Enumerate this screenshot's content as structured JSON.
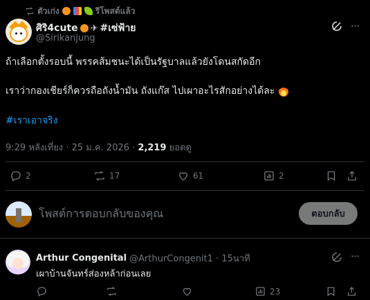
{
  "repost_bar": {
    "label": "ตัวเก่ง",
    "suffix": "รีโพสต์แล้ว"
  },
  "post": {
    "author_name": "ศิริ4cute",
    "author_tag": "#เซ่ฟ้าย",
    "handle": "@Sirikanjung",
    "line1": "ถ้าเลือกตั้งรอบนี้ พรรคส้มชนะได้เป็นรัฐบาลแล้วยังโดนสกัดอีก",
    "line2": "เราว่ากองเชียร์ก็ควรถือถังน้ำมัน ถังแก๊ส ไปเผาอะไรสักอย่างได้ละ",
    "hashtag": "#เราเอาจริง",
    "timestamp": "9:29 หลังเที่ยง · 25 ม.ค. 2026 · ",
    "views_count": "2,219",
    "views_label": " ยอดดู",
    "stats": {
      "replies": "2",
      "reposts": "17",
      "likes": "61",
      "views": "2"
    }
  },
  "reply_composer": {
    "placeholder": "โพสต์การตอบกลับของคุณ",
    "button_label": "ตอบกลับ"
  },
  "comment": {
    "author_name": "Arthur Congenital",
    "handle_time": "@ArthurCongenit1 · 15นาที",
    "text": "เผาบ้านจันทร์ส่องหล้าก่อนเลย",
    "stats": {
      "views": "23"
    }
  },
  "colors": {
    "background": "#000000",
    "text": "#e7e9ea",
    "muted": "#71767b",
    "link": "#1d9bf0",
    "border": "#2f3336",
    "reply_button": "#787a7a"
  }
}
